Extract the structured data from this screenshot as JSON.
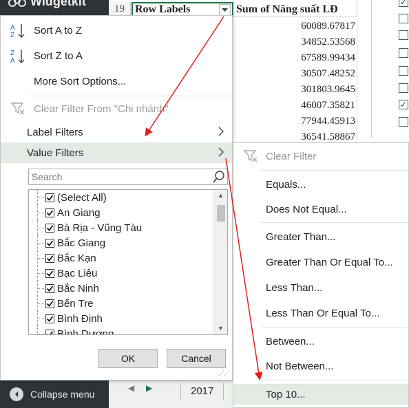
{
  "app": {
    "title": "Widgetkit",
    "collapse_label": "Collapse menu"
  },
  "sheet": {
    "row_number": "19",
    "header_row_labels": "Row Labels",
    "header_sum": "Sum of Năng suất LĐ",
    "values": [
      "60089.67817",
      "34852.53568",
      "67589.99434",
      "30507.48252",
      "301803.9645",
      "46007.35821",
      "77944.45913",
      "36541.58867"
    ],
    "tab_label": "2017",
    "right_checkboxes": [
      true,
      false,
      false,
      false,
      false,
      false,
      true,
      false
    ]
  },
  "dropdown": {
    "sort_az": "Sort A to Z",
    "sort_za": "Sort Z to A",
    "more_sort": "More Sort Options...",
    "clear_filter": "Clear Filter From \"Chi nhánh\"",
    "label_filters": "Label Filters",
    "value_filters": "Value Filters",
    "search_placeholder": "Search",
    "items": [
      {
        "label": "(Select All)",
        "checked": true
      },
      {
        "label": "An Giang",
        "checked": true
      },
      {
        "label": "Bà Rịa - Vũng Tàu",
        "checked": true
      },
      {
        "label": "Bắc Giang",
        "checked": true
      },
      {
        "label": "Bắc Kạn",
        "checked": true
      },
      {
        "label": "Bạc Liêu",
        "checked": true
      },
      {
        "label": "Bắc Ninh",
        "checked": true
      },
      {
        "label": "Bến Tre",
        "checked": true
      },
      {
        "label": "Bình Định",
        "checked": true
      },
      {
        "label": "Bình Dương",
        "checked": true
      }
    ],
    "ok_label": "OK",
    "cancel_label": "Cancel"
  },
  "submenu": {
    "clear_filter": "Clear Filter",
    "equals": "Equals...",
    "does_not_equal": "Does Not Equal...",
    "greater_than": "Greater Than...",
    "greater_equal": "Greater Than Or Equal To...",
    "less_than": "Less Than...",
    "less_equal": "Less Than Or Equal To...",
    "between": "Between...",
    "not_between": "Not Between...",
    "top10": "Top 10..."
  },
  "colors": {
    "excel_green": "#217346",
    "dark_sidebar": "#2e3338",
    "highlight": "#e3eae4",
    "annotation_red": "#e02020"
  }
}
